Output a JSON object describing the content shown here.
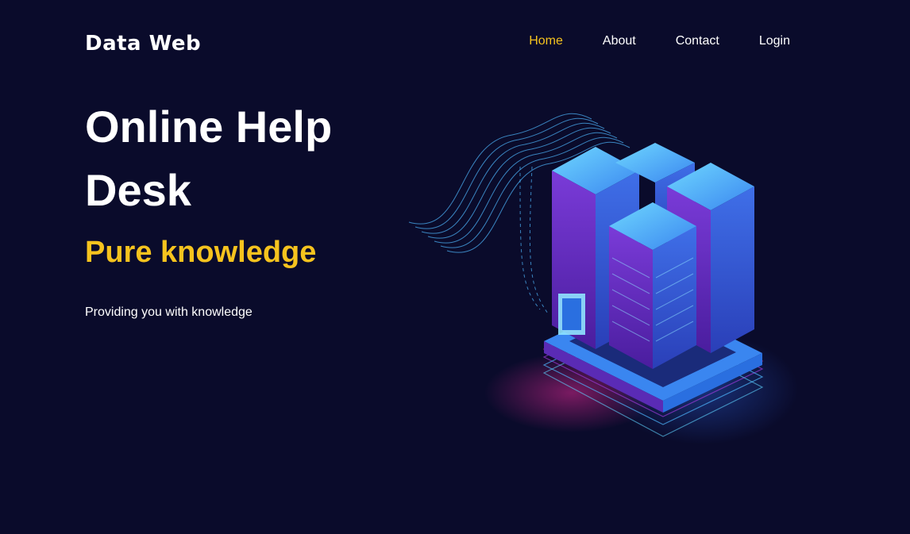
{
  "header": {
    "logo": "Data Web",
    "nav": [
      {
        "label": "Home",
        "active": true
      },
      {
        "label": "About",
        "active": false
      },
      {
        "label": "Contact",
        "active": false
      },
      {
        "label": "Login",
        "active": false
      }
    ]
  },
  "hero": {
    "title": "Online Help Desk",
    "subtitle": "Pure knowledge",
    "description": "Providing you with knowledge"
  },
  "illustration": {
    "icon": "server-datacenter-icon"
  },
  "colors": {
    "background": "#0a0b2b",
    "accent": "#f6c31e",
    "text": "#ffffff",
    "server_blue": "#3d7cf2",
    "server_purple": "#5a2bb5",
    "glow_cyan": "#5fd3ff",
    "glow_magenta": "#d6278f"
  }
}
